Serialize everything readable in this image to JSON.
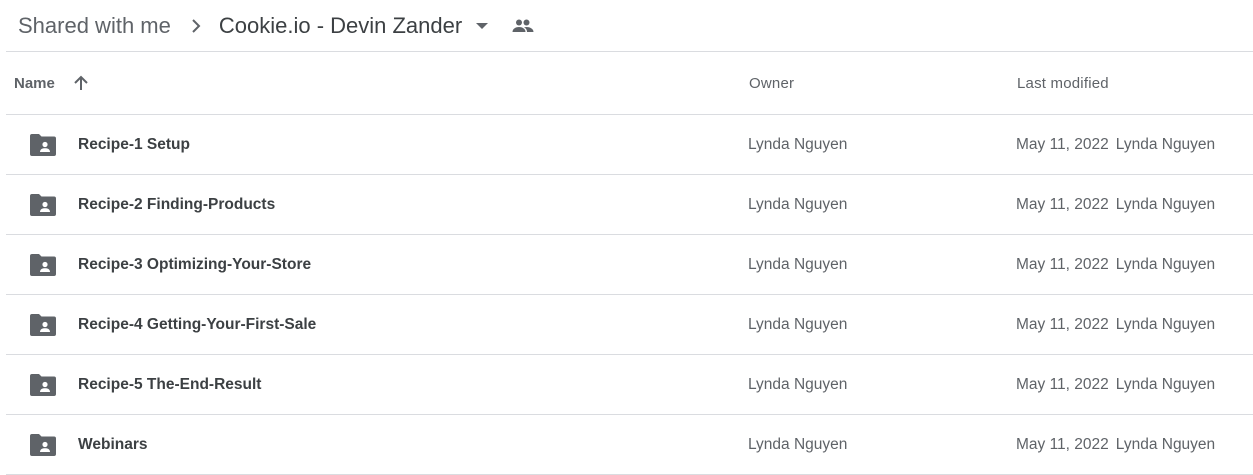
{
  "breadcrumb": {
    "parent": "Shared with me",
    "current": "Cookie.io - Devin Zander",
    "separator_icon": "chevron-right-icon",
    "dropdown_icon": "caret-down-icon",
    "shared_icon": "people-icon"
  },
  "columns": {
    "name": "Name",
    "name_sort_icon": "arrow-up-icon",
    "owner": "Owner",
    "last_modified": "Last modified"
  },
  "rows": [
    {
      "name": "Recipe-1 Setup",
      "owner": "Lynda Nguyen",
      "date": "May 11, 2022",
      "modified_by": "Lynda Nguyen",
      "icon": "shared-folder-icon"
    },
    {
      "name": "Recipe-2 Finding-Products",
      "owner": "Lynda Nguyen",
      "date": "May 11, 2022",
      "modified_by": "Lynda Nguyen",
      "icon": "shared-folder-icon"
    },
    {
      "name": "Recipe-3 Optimizing-Your-Store",
      "owner": "Lynda Nguyen",
      "date": "May 11, 2022",
      "modified_by": "Lynda Nguyen",
      "icon": "shared-folder-icon"
    },
    {
      "name": "Recipe-4 Getting-Your-First-Sale",
      "owner": "Lynda Nguyen",
      "date": "May 11, 2022",
      "modified_by": "Lynda Nguyen",
      "icon": "shared-folder-icon"
    },
    {
      "name": "Recipe-5 The-End-Result",
      "owner": "Lynda Nguyen",
      "date": "May 11, 2022",
      "modified_by": "Lynda Nguyen",
      "icon": "shared-folder-icon"
    },
    {
      "name": "Webinars",
      "owner": "Lynda Nguyen",
      "date": "May 11, 2022",
      "modified_by": "Lynda Nguyen",
      "icon": "shared-folder-icon"
    }
  ],
  "colors": {
    "text_primary": "#3c4043",
    "text_secondary": "#5f6368",
    "divider": "#dadce0",
    "folder_icon": "#5f6368"
  }
}
